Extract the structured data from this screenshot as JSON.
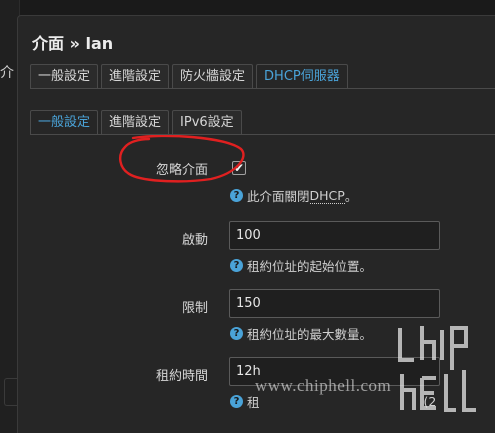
{
  "background": {
    "peek_title": "介"
  },
  "modal": {
    "title": "介面 » lan"
  },
  "tabs": [
    {
      "label": "一般設定",
      "active": false
    },
    {
      "label": "進階設定",
      "active": false
    },
    {
      "label": "防火牆設定",
      "active": false
    },
    {
      "label": "DHCP伺服器",
      "active": true
    }
  ],
  "subtabs": [
    {
      "label": "一般設定",
      "active": true
    },
    {
      "label": "進階設定",
      "active": false
    },
    {
      "label": "IPv6設定",
      "active": false
    }
  ],
  "form": {
    "ignore": {
      "label": "忽略介面",
      "checked": "✔",
      "help_prefix": "此介面關閉",
      "help_abbr": "DHCP",
      "help_suffix": "。"
    },
    "start": {
      "label": "啟動",
      "value": "100",
      "help": "租約位址的起始位置。"
    },
    "limit": {
      "label": "限制",
      "value": "150",
      "help": "租約位址的最大數量。"
    },
    "leasetime": {
      "label": "租約時間",
      "value": "12h",
      "help_prefix": "租",
      "help_suffix": "(2"
    }
  },
  "watermark": {
    "text": "www.chiphell.com"
  },
  "colors": {
    "accent": "#4aa3d8",
    "annotation": "#e02020"
  }
}
